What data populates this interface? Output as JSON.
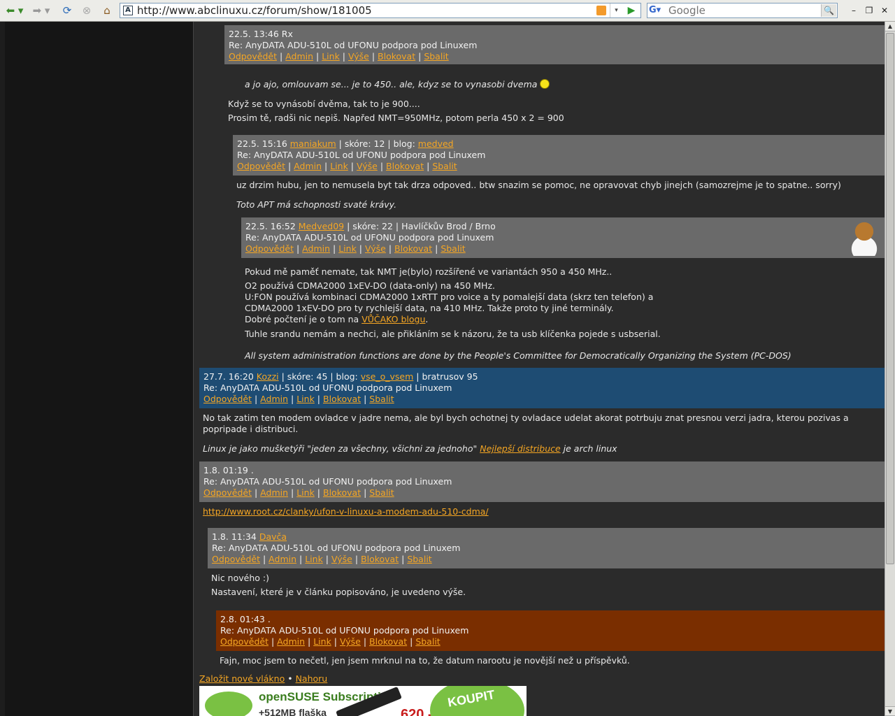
{
  "browser": {
    "url": "http://www.abclinuxu.cz/forum/show/181005",
    "search_placeholder": "Google"
  },
  "comments": [
    {
      "meta": "22.5. 13:46 Rx",
      "subject": "Re: AnyDATA ADU-510L od UFONU podpora pod Linuxem",
      "actions": [
        "Odpovědět",
        "Admin",
        "Link",
        "Výše",
        "Blokovat",
        "Sbalit"
      ],
      "lines": [
        "a jo ajo, omlouvam se... je to 450.. ale, kdyz se to vynasobi dvema",
        "Když se to vynásobí dvěma, tak to je 900....",
        "Prosim tě, radši nic nepiš. Napřed NMT=950MHz, potom perla 450 x 2 = 900"
      ]
    },
    {
      "meta_prefix": "22.5. 15:16",
      "author": "maniakum",
      "meta_mid": "| skóre: 12 | blog:",
      "blog": "medved",
      "subject": "Re: AnyDATA ADU-510L od UFONU podpora pod Linuxem",
      "actions": [
        "Odpovědět",
        "Admin",
        "Link",
        "Výše",
        "Blokovat",
        "Sbalit"
      ],
      "lines": [
        "uz drzim hubu, jen to nemusela byt tak drza odpoved.. btw snazim se pomoc, ne opravovat chyb jinejch (samozrejme je to spatne.. sorry)"
      ],
      "signature": "Toto APT má schopnosti svaté krávy."
    },
    {
      "meta_prefix": "22.5. 16:52",
      "author": "Medved09",
      "meta_mid": "| skóre: 22 | Havlíčkův Brod / Brno",
      "subject": "Re: AnyDATA ADU-510L od UFONU podpora pod Linuxem",
      "actions": [
        "Odpovědět",
        "Admin",
        "Link",
        "Výše",
        "Blokovat",
        "Sbalit"
      ],
      "lines": [
        "Pokud mě paměť nemate, tak NMT je(bylo) rozšířené ve variantách 950 a 450 MHz..",
        "O2 používá CDMA2000 1xEV-DO (data-only) na 450 MHz.",
        "U:FON používá kombinaci CDMA2000 1xRTT pro voice a ty pomalejší data (skrz ten telefon) a",
        "CDMA2000 1xEV-DO pro ty rychlejší data, na 410 MHz. Takže proto ty jiné terminály.",
        "Dobré počtení je o tom na",
        "Tuhle srandu nemám a nechci, ale přikláním se k názoru, že ta usb klíčenka pojede s usbserial."
      ],
      "link": "VŮČAKO blogu",
      "signature": "All system administration functions are done by the People's Committee for Democratically Organizing the System (PC-DOS)"
    },
    {
      "meta_prefix": "27.7. 16:20",
      "author": "Kozzi",
      "meta_mid": "| skóre: 45 | blog:",
      "blog": "vse_o_vsem",
      "meta_suffix": "| bratrusov 95",
      "subject": "Re: AnyDATA ADU-510L od UFONU podpora pod Linuxem",
      "actions": [
        "Odpovědět",
        "Admin",
        "Link",
        "Blokovat",
        "Sbalit"
      ],
      "lines": [
        "No tak zatim ten modem ovladce v jadre nema, ale byl bych ochotnej ty ovladace udelat akorat potrbuju znat presnou verzi jadra, kterou pozivas a popripade i distribuci."
      ],
      "signature_prefix": "Linux je jako mušketýři \"jeden za všechny, všichni za jednoho\"",
      "signature_link": "Nejlepší distribuce",
      "signature_suffix": "je arch linux"
    },
    {
      "meta": "1.8. 01:19 .",
      "subject": "Re: AnyDATA ADU-510L od UFONU podpora pod Linuxem",
      "actions": [
        "Odpovědět",
        "Admin",
        "Link",
        "Blokovat",
        "Sbalit"
      ],
      "link": "http://www.root.cz/clanky/ufon-v-linuxu-a-modem-adu-510-cdma/"
    },
    {
      "meta_prefix": "1.8. 11:34",
      "author": "Davča",
      "subject": "Re: AnyDATA ADU-510L od UFONU podpora pod Linuxem",
      "actions": [
        "Odpovědět",
        "Admin",
        "Link",
        "Výše",
        "Blokovat",
        "Sbalit"
      ],
      "lines": [
        "Nic nového :)",
        "Nastavení, které je v článku popisováno, je uvedeno výše."
      ]
    },
    {
      "meta": "2.8. 01:43 .",
      "subject": "Re: AnyDATA ADU-510L od UFONU podpora pod Linuxem",
      "actions": [
        "Odpovědět",
        "Admin",
        "Link",
        "Výše",
        "Blokovat",
        "Sbalit"
      ],
      "lines": [
        "Fajn, moc jsem to nečetl, jen jsem mrknul na to, že datum narootu je novější než u příspěvků."
      ]
    }
  ],
  "footer": {
    "new_thread": "Založit nové vlákno",
    "bullet": "•",
    "top": "Nahoru"
  },
  "banner": {
    "title": "openSUSE Subscription",
    "sub": "+512MB flaška",
    "price": "620,-",
    "buy": "KOUPIT"
  }
}
